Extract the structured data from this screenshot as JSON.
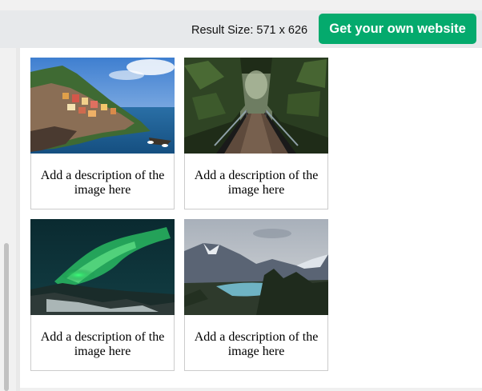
{
  "toolbar": {
    "result_size": "Result Size: 571 x 626",
    "cta_label": "Get your own website",
    "accent_color": "#04aa6d"
  },
  "gallery": {
    "items": [
      {
        "image": "cinque-terre-coastal-village",
        "description": "Add a description of the image here"
      },
      {
        "image": "forest-footbridge",
        "description": "Add a description of the image here"
      },
      {
        "image": "northern-lights",
        "description": "Add a description of the image here"
      },
      {
        "image": "mountain-lake",
        "description": "Add a description of the image here"
      }
    ]
  }
}
